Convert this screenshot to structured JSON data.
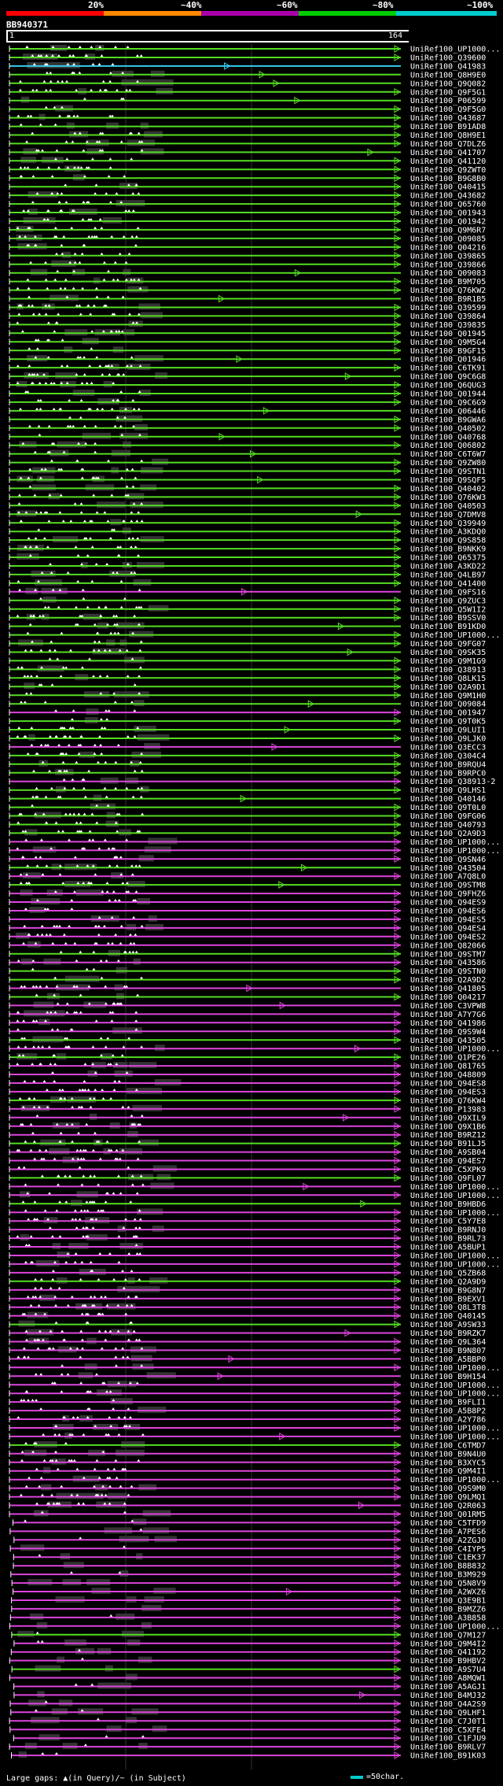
{
  "legend": {
    "labels": [
      "20%",
      "~40%",
      "~60%",
      "~80%",
      "~100%"
    ],
    "colors": [
      "#ff0000",
      "#ff8800",
      "#aa00aa",
      "#00cc00",
      "#00cccc"
    ]
  },
  "query": {
    "id": "BB940371",
    "start": "1",
    "end": "164"
  },
  "footer": {
    "gaps_text": "Large gaps: ▲(in Query)/~ (in Subject)",
    "scale_label": "=50char.",
    "scale_color": "#00cccc"
  },
  "colors": {
    "green": "#55dd22",
    "magenta": "#dd44dd",
    "cyan": "#33ccee",
    "gap": "#333333"
  },
  "hits": [
    {
      "name": "UniRef100_UP1000...",
      "color": "green"
    },
    {
      "name": "UniRef100_Q39600",
      "color": "green"
    },
    {
      "name": "UniRef100_Q41983",
      "color": "cyan"
    },
    {
      "name": "UniRef100_Q8H9E0",
      "color": "green"
    },
    {
      "name": "UniRef100_Q9Q082",
      "color": "green"
    },
    {
      "name": "UniRef100_Q9F5G1",
      "color": "green"
    },
    {
      "name": "UniRef100_P06599",
      "color": "green"
    },
    {
      "name": "UniRef100_Q9F5G0",
      "color": "green"
    },
    {
      "name": "UniRef100_Q43687",
      "color": "green"
    },
    {
      "name": "UniRef100_B91AD8",
      "color": "green"
    },
    {
      "name": "UniRef100_Q8H9E1",
      "color": "green"
    },
    {
      "name": "UniRef100_Q7DLZ6",
      "color": "green"
    },
    {
      "name": "UniRef100_Q41707",
      "color": "green"
    },
    {
      "name": "UniRef100_Q41120",
      "color": "green"
    },
    {
      "name": "UniRef100_Q9ZWT0",
      "color": "green"
    },
    {
      "name": "UniRef100_B9G8B0",
      "color": "green"
    },
    {
      "name": "UniRef100_Q40415",
      "color": "green"
    },
    {
      "name": "UniRef100_Q43682",
      "color": "green"
    },
    {
      "name": "UniRef100_Q65760",
      "color": "green"
    },
    {
      "name": "UniRef100_Q01943",
      "color": "green"
    },
    {
      "name": "UniRef100_Q01942",
      "color": "green"
    },
    {
      "name": "UniRef100_Q9M6R7",
      "color": "green"
    },
    {
      "name": "UniRef100_Q09085",
      "color": "green"
    },
    {
      "name": "UniRef100_Q04216",
      "color": "green"
    },
    {
      "name": "UniRef100_Q39865",
      "color": "green"
    },
    {
      "name": "UniRef100_Q39866",
      "color": "green"
    },
    {
      "name": "UniRef100_Q09083",
      "color": "green"
    },
    {
      "name": "UniRef100_B9M705",
      "color": "green"
    },
    {
      "name": "UniRef100_Q76KW2",
      "color": "green"
    },
    {
      "name": "UniRef100_B9R1B5",
      "color": "green"
    },
    {
      "name": "UniRef100_Q39599",
      "color": "green"
    },
    {
      "name": "UniRef100_Q39864",
      "color": "green"
    },
    {
      "name": "UniRef100_Q39835",
      "color": "green"
    },
    {
      "name": "UniRef100_Q01945",
      "color": "green"
    },
    {
      "name": "UniRef100_Q9M5G4",
      "color": "green"
    },
    {
      "name": "UniRef100_B9GF15",
      "color": "green"
    },
    {
      "name": "UniRef100_Q01946",
      "color": "green"
    },
    {
      "name": "UniRef100_C6TK91",
      "color": "green"
    },
    {
      "name": "UniRef100_Q9C6G8",
      "color": "green"
    },
    {
      "name": "UniRef100_Q6QUG3",
      "color": "green"
    },
    {
      "name": "UniRef100_Q01944",
      "color": "green"
    },
    {
      "name": "UniRef100_Q9C6G9",
      "color": "green"
    },
    {
      "name": "UniRef100_Q06446",
      "color": "green"
    },
    {
      "name": "UniRef100_B9GWA6",
      "color": "green"
    },
    {
      "name": "UniRef100_Q40502",
      "color": "green"
    },
    {
      "name": "UniRef100_Q40768",
      "color": "green"
    },
    {
      "name": "UniRef100_Q06802",
      "color": "green"
    },
    {
      "name": "UniRef100_C6T6W7",
      "color": "green"
    },
    {
      "name": "UniRef100_Q9ZW80",
      "color": "green"
    },
    {
      "name": "UniRef100_Q9STN1",
      "color": "green"
    },
    {
      "name": "UniRef100_Q9SQF5",
      "color": "green"
    },
    {
      "name": "UniRef100_Q40402",
      "color": "green"
    },
    {
      "name": "UniRef100_Q76KW3",
      "color": "green"
    },
    {
      "name": "UniRef100_Q40503",
      "color": "green"
    },
    {
      "name": "UniRef100_Q7DMV8",
      "color": "green"
    },
    {
      "name": "UniRef100_Q39949",
      "color": "green"
    },
    {
      "name": "UniRef100_A3KDQ0",
      "color": "green"
    },
    {
      "name": "UniRef100_Q9S858",
      "color": "green"
    },
    {
      "name": "UniRef100_B9NKK9",
      "color": "green"
    },
    {
      "name": "UniRef100_Q65375",
      "color": "green"
    },
    {
      "name": "UniRef100_A3KD22",
      "color": "green"
    },
    {
      "name": "UniRef100_Q4LB97",
      "color": "green"
    },
    {
      "name": "UniRef100_Q41400",
      "color": "green"
    },
    {
      "name": "UniRef100_Q9FS16",
      "color": "magenta"
    },
    {
      "name": "UniRef100_Q9ZUC3",
      "color": "green"
    },
    {
      "name": "UniRef100_Q5W1I2",
      "color": "green"
    },
    {
      "name": "UniRef100_B9SSV0",
      "color": "green"
    },
    {
      "name": "UniRef100_B91KD0",
      "color": "green"
    },
    {
      "name": "UniRef100_UP1000...",
      "color": "green"
    },
    {
      "name": "UniRef100_Q9FG07",
      "color": "green"
    },
    {
      "name": "UniRef100_Q9SK35",
      "color": "green"
    },
    {
      "name": "UniRef100_Q9M1G9",
      "color": "green"
    },
    {
      "name": "UniRef100_Q38913",
      "color": "green"
    },
    {
      "name": "UniRef100_Q8LK15",
      "color": "green"
    },
    {
      "name": "UniRef100_Q2A9D1",
      "color": "green"
    },
    {
      "name": "UniRef100_Q9M1H0",
      "color": "green"
    },
    {
      "name": "UniRef100_Q09084",
      "color": "green"
    },
    {
      "name": "UniRef100_Q01947",
      "color": "magenta"
    },
    {
      "name": "UniRef100_Q9T0K5",
      "color": "green"
    },
    {
      "name": "UniRef100_Q9LUI1",
      "color": "green"
    },
    {
      "name": "UniRef100_Q9LJK0",
      "color": "green"
    },
    {
      "name": "UniRef100_Q3ECC3",
      "color": "magenta"
    },
    {
      "name": "UniRef100_Q304C4",
      "color": "green"
    },
    {
      "name": "UniRef100_B9RQU4",
      "color": "green"
    },
    {
      "name": "UniRef100_B9RPC0",
      "color": "green"
    },
    {
      "name": "UniRef100_Q38913-2",
      "color": "magenta"
    },
    {
      "name": "UniRef100_Q9LHS1",
      "color": "green"
    },
    {
      "name": "UniRef100_Q40146",
      "color": "green"
    },
    {
      "name": "UniRef100_Q9T0L0",
      "color": "green"
    },
    {
      "name": "UniRef100_Q9FG06",
      "color": "green"
    },
    {
      "name": "UniRef100_Q40793",
      "color": "green"
    },
    {
      "name": "UniRef100_Q2A9D3",
      "color": "green"
    },
    {
      "name": "UniRef100_UP1000...",
      "color": "magenta"
    },
    {
      "name": "UniRef100_UP1000...",
      "color": "magenta"
    },
    {
      "name": "UniRef100_Q9SN46",
      "color": "magenta"
    },
    {
      "name": "UniRef100_Q43504",
      "color": "green"
    },
    {
      "name": "UniRef100_A7Q8L0",
      "color": "magenta"
    },
    {
      "name": "UniRef100_Q9STM8",
      "color": "green"
    },
    {
      "name": "UniRef100_Q9FHZ6",
      "color": "magenta"
    },
    {
      "name": "UniRef100_Q94ES9",
      "color": "magenta"
    },
    {
      "name": "UniRef100_Q94ES6",
      "color": "magenta"
    },
    {
      "name": "UniRef100_Q94ES5",
      "color": "magenta"
    },
    {
      "name": "UniRef100_Q94ES4",
      "color": "magenta"
    },
    {
      "name": "UniRef100_Q94ES2",
      "color": "magenta"
    },
    {
      "name": "UniRef100_Q82066",
      "color": "magenta"
    },
    {
      "name": "UniRef100_Q9STM7",
      "color": "green"
    },
    {
      "name": "UniRef100_Q43586",
      "color": "magenta"
    },
    {
      "name": "UniRef100_Q9STN0",
      "color": "green"
    },
    {
      "name": "UniRef100_Q2A9D2",
      "color": "green"
    },
    {
      "name": "UniRef100_Q41805",
      "color": "magenta"
    },
    {
      "name": "UniRef100_Q04217",
      "color": "green"
    },
    {
      "name": "UniRef100_C3VPW8",
      "color": "magenta"
    },
    {
      "name": "UniRef100_A7Y7G6",
      "color": "magenta"
    },
    {
      "name": "UniRef100_Q41986",
      "color": "magenta"
    },
    {
      "name": "UniRef100_Q9S9W4",
      "color": "magenta"
    },
    {
      "name": "UniRef100_Q43505",
      "color": "green"
    },
    {
      "name": "UniRef100_UP1000...",
      "color": "magenta"
    },
    {
      "name": "UniRef100_Q1PE26",
      "color": "green"
    },
    {
      "name": "UniRef100_Q81765",
      "color": "magenta"
    },
    {
      "name": "UniRef100_Q48809",
      "color": "magenta"
    },
    {
      "name": "UniRef100_Q94ES8",
      "color": "magenta"
    },
    {
      "name": "UniRef100_Q94ES3",
      "color": "magenta"
    },
    {
      "name": "UniRef100_Q76KW4",
      "color": "green"
    },
    {
      "name": "UniRef100_P13983",
      "color": "magenta"
    },
    {
      "name": "UniRef100_Q9XIL9",
      "color": "magenta"
    },
    {
      "name": "UniRef100_Q9X1B6",
      "color": "magenta"
    },
    {
      "name": "UniRef100_B9RZ12",
      "color": "magenta"
    },
    {
      "name": "UniRef100_B91LJ5",
      "color": "green"
    },
    {
      "name": "UniRef100_A9SB04",
      "color": "magenta"
    },
    {
      "name": "UniRef100_Q94ES7",
      "color": "magenta"
    },
    {
      "name": "UniRef100_C5XPK9",
      "color": "magenta"
    },
    {
      "name": "UniRef100_Q9FL07",
      "color": "green"
    },
    {
      "name": "UniRef100_UP1000...",
      "color": "magenta"
    },
    {
      "name": "UniRef100_UP1000...",
      "color": "magenta"
    },
    {
      "name": "UniRef100_B9HBD6",
      "color": "green"
    },
    {
      "name": "UniRef100_UP1000...",
      "color": "magenta"
    },
    {
      "name": "UniRef100_C5Y7E8",
      "color": "magenta"
    },
    {
      "name": "UniRef100_B9RNJ0",
      "color": "magenta"
    },
    {
      "name": "UniRef100_B9RL73",
      "color": "magenta"
    },
    {
      "name": "UniRef100_A5BUP1",
      "color": "magenta"
    },
    {
      "name": "UniRef100_UP1000...",
      "color": "magenta"
    },
    {
      "name": "UniRef100_UP1000...",
      "color": "magenta"
    },
    {
      "name": "UniRef100_Q5ZB68",
      "color": "magenta"
    },
    {
      "name": "UniRef100_Q2A9D9",
      "color": "green"
    },
    {
      "name": "UniRef100_B9G8N7",
      "color": "magenta"
    },
    {
      "name": "UniRef100_B9EXV1",
      "color": "magenta"
    },
    {
      "name": "UniRef100_Q8L3T8",
      "color": "magenta"
    },
    {
      "name": "UniRef100_Q40145",
      "color": "magenta"
    },
    {
      "name": "UniRef100_A9SW33",
      "color": "green"
    },
    {
      "name": "UniRef100_B9RZK7",
      "color": "magenta"
    },
    {
      "name": "UniRef100_Q9L364",
      "color": "magenta"
    },
    {
      "name": "UniRef100_B9N807",
      "color": "magenta"
    },
    {
      "name": "UniRef100_A5BBP0",
      "color": "magenta"
    },
    {
      "name": "UniRef100_UP1000...",
      "color": "magenta"
    },
    {
      "name": "UniRef100_B9H154",
      "color": "magenta"
    },
    {
      "name": "UniRef100_UP1000...",
      "color": "magenta"
    },
    {
      "name": "UniRef100_UP1000...",
      "color": "magenta"
    },
    {
      "name": "UniRef100_B9FLI1",
      "color": "magenta"
    },
    {
      "name": "UniRef100_A5B8P2",
      "color": "magenta"
    },
    {
      "name": "UniRef100_A2Y786",
      "color": "magenta"
    },
    {
      "name": "UniRef100_UP1000...",
      "color": "magenta"
    },
    {
      "name": "UniRef100_UP1000...",
      "color": "magenta"
    },
    {
      "name": "UniRef100_C6TMD7",
      "color": "green"
    },
    {
      "name": "UniRef100_B9N4U0",
      "color": "magenta"
    },
    {
      "name": "UniRef100_B3XYC5",
      "color": "magenta"
    },
    {
      "name": "UniRef100_Q9M4I1",
      "color": "magenta"
    },
    {
      "name": "UniRef100_UP1000...",
      "color": "magenta"
    },
    {
      "name": "UniRef100_Q9S9M0",
      "color": "magenta"
    },
    {
      "name": "UniRef100_Q9LMQ1",
      "color": "magenta"
    },
    {
      "name": "UniRef100_Q2R063",
      "color": "magenta"
    },
    {
      "name": "UniRef100_Q01RM5",
      "color": "magenta"
    },
    {
      "name": "UniRef100_C5TFD9",
      "color": "magenta"
    },
    {
      "name": "UniRef100_A7PES6",
      "color": "magenta"
    },
    {
      "name": "UniRef100_A2ZGJ0",
      "color": "magenta"
    },
    {
      "name": "UniRef100_C4IYP5",
      "color": "magenta"
    },
    {
      "name": "UniRef100_C1EK37",
      "color": "magenta"
    },
    {
      "name": "UniRef100_B8B832",
      "color": "magenta"
    },
    {
      "name": "UniRef100_B3M929",
      "color": "magenta"
    },
    {
      "name": "UniRef100_Q5N8V9",
      "color": "magenta"
    },
    {
      "name": "UniRef100_A2WXZ6",
      "color": "magenta"
    },
    {
      "name": "UniRef100_Q3E9B1",
      "color": "magenta"
    },
    {
      "name": "UniRef100_B9MZZ6",
      "color": "magenta"
    },
    {
      "name": "UniRef100_A3B858",
      "color": "magenta"
    },
    {
      "name": "UniRef100_UP1000...",
      "color": "magenta"
    },
    {
      "name": "UniRef100_Q7M127",
      "color": "green"
    },
    {
      "name": "UniRef100_Q9M4I2",
      "color": "magenta"
    },
    {
      "name": "UniRef100_Q41192",
      "color": "magenta"
    },
    {
      "name": "UniRef100_B9HBV2",
      "color": "magenta"
    },
    {
      "name": "UniRef100_A9S7U4",
      "color": "green"
    },
    {
      "name": "UniRef100_A8MQW1",
      "color": "magenta"
    },
    {
      "name": "UniRef100_A5AGJ1",
      "color": "magenta"
    },
    {
      "name": "UniRef100_B4MJ32",
      "color": "magenta"
    },
    {
      "name": "UniRef100_Q4A2S9",
      "color": "magenta"
    },
    {
      "name": "UniRef100_Q9LHF1",
      "color": "magenta"
    },
    {
      "name": "UniRef100_C7J0T1",
      "color": "magenta"
    },
    {
      "name": "UniRef100_C5XFE4",
      "color": "magenta"
    },
    {
      "name": "UniRef100_C1FJU9",
      "color": "magenta"
    },
    {
      "name": "UniRef100_B9RLV7",
      "color": "magenta"
    },
    {
      "name": "UniRef100_B91K03",
      "color": "magenta"
    }
  ]
}
